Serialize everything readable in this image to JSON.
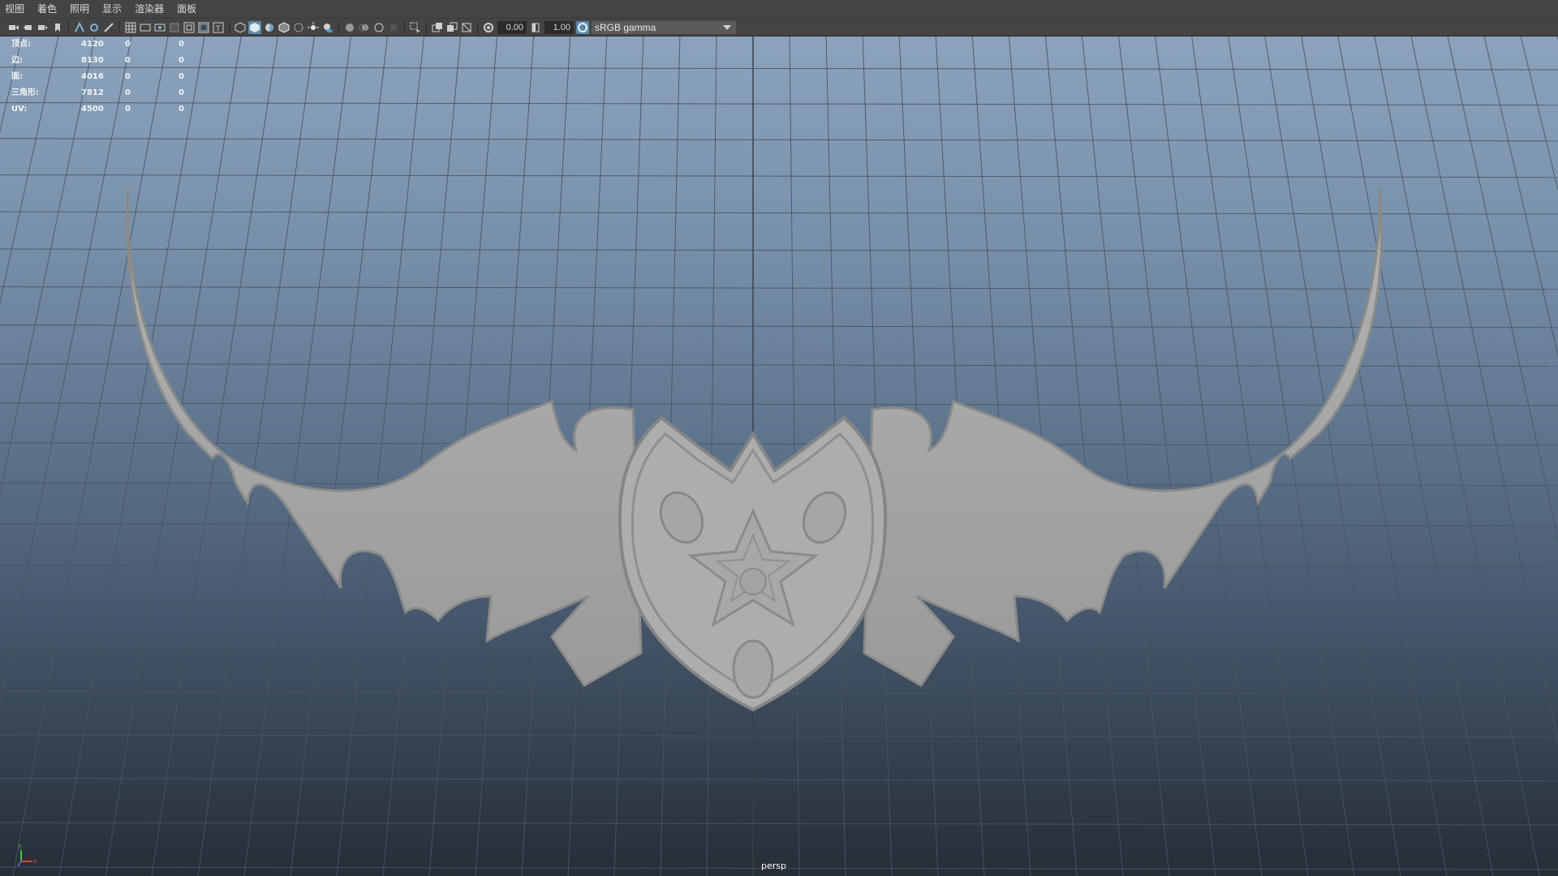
{
  "menu": {
    "items": [
      "视图",
      "着色",
      "照明",
      "显示",
      "渲染器",
      "面板"
    ]
  },
  "toolbar": {
    "exposure_value": "0.00",
    "gamma_value": "1.00",
    "color_space": "sRGB gamma"
  },
  "hud": {
    "rows": [
      {
        "label": "顶点:",
        "v1": "4120",
        "v2": "0",
        "v3": "0"
      },
      {
        "label": "边:",
        "v1": "8130",
        "v2": "0",
        "v3": "0"
      },
      {
        "label": "面:",
        "v1": "4016",
        "v2": "0",
        "v3": "0"
      },
      {
        "label": "三角形:",
        "v1": "7812",
        "v2": "0",
        "v3": "0"
      },
      {
        "label": "UV:",
        "v1": "4500",
        "v2": "0",
        "v3": "0"
      }
    ]
  },
  "viewport": {
    "camera_label": "persp"
  },
  "colors": {
    "menubar_bg": "#444444",
    "viewport_top": "#8ba3bd",
    "viewport_bottom": "#262d36",
    "model_fill": "#a9a9a9",
    "active_icon": "#5d8aa8"
  },
  "axis": {
    "x": "x",
    "y": "Y"
  }
}
